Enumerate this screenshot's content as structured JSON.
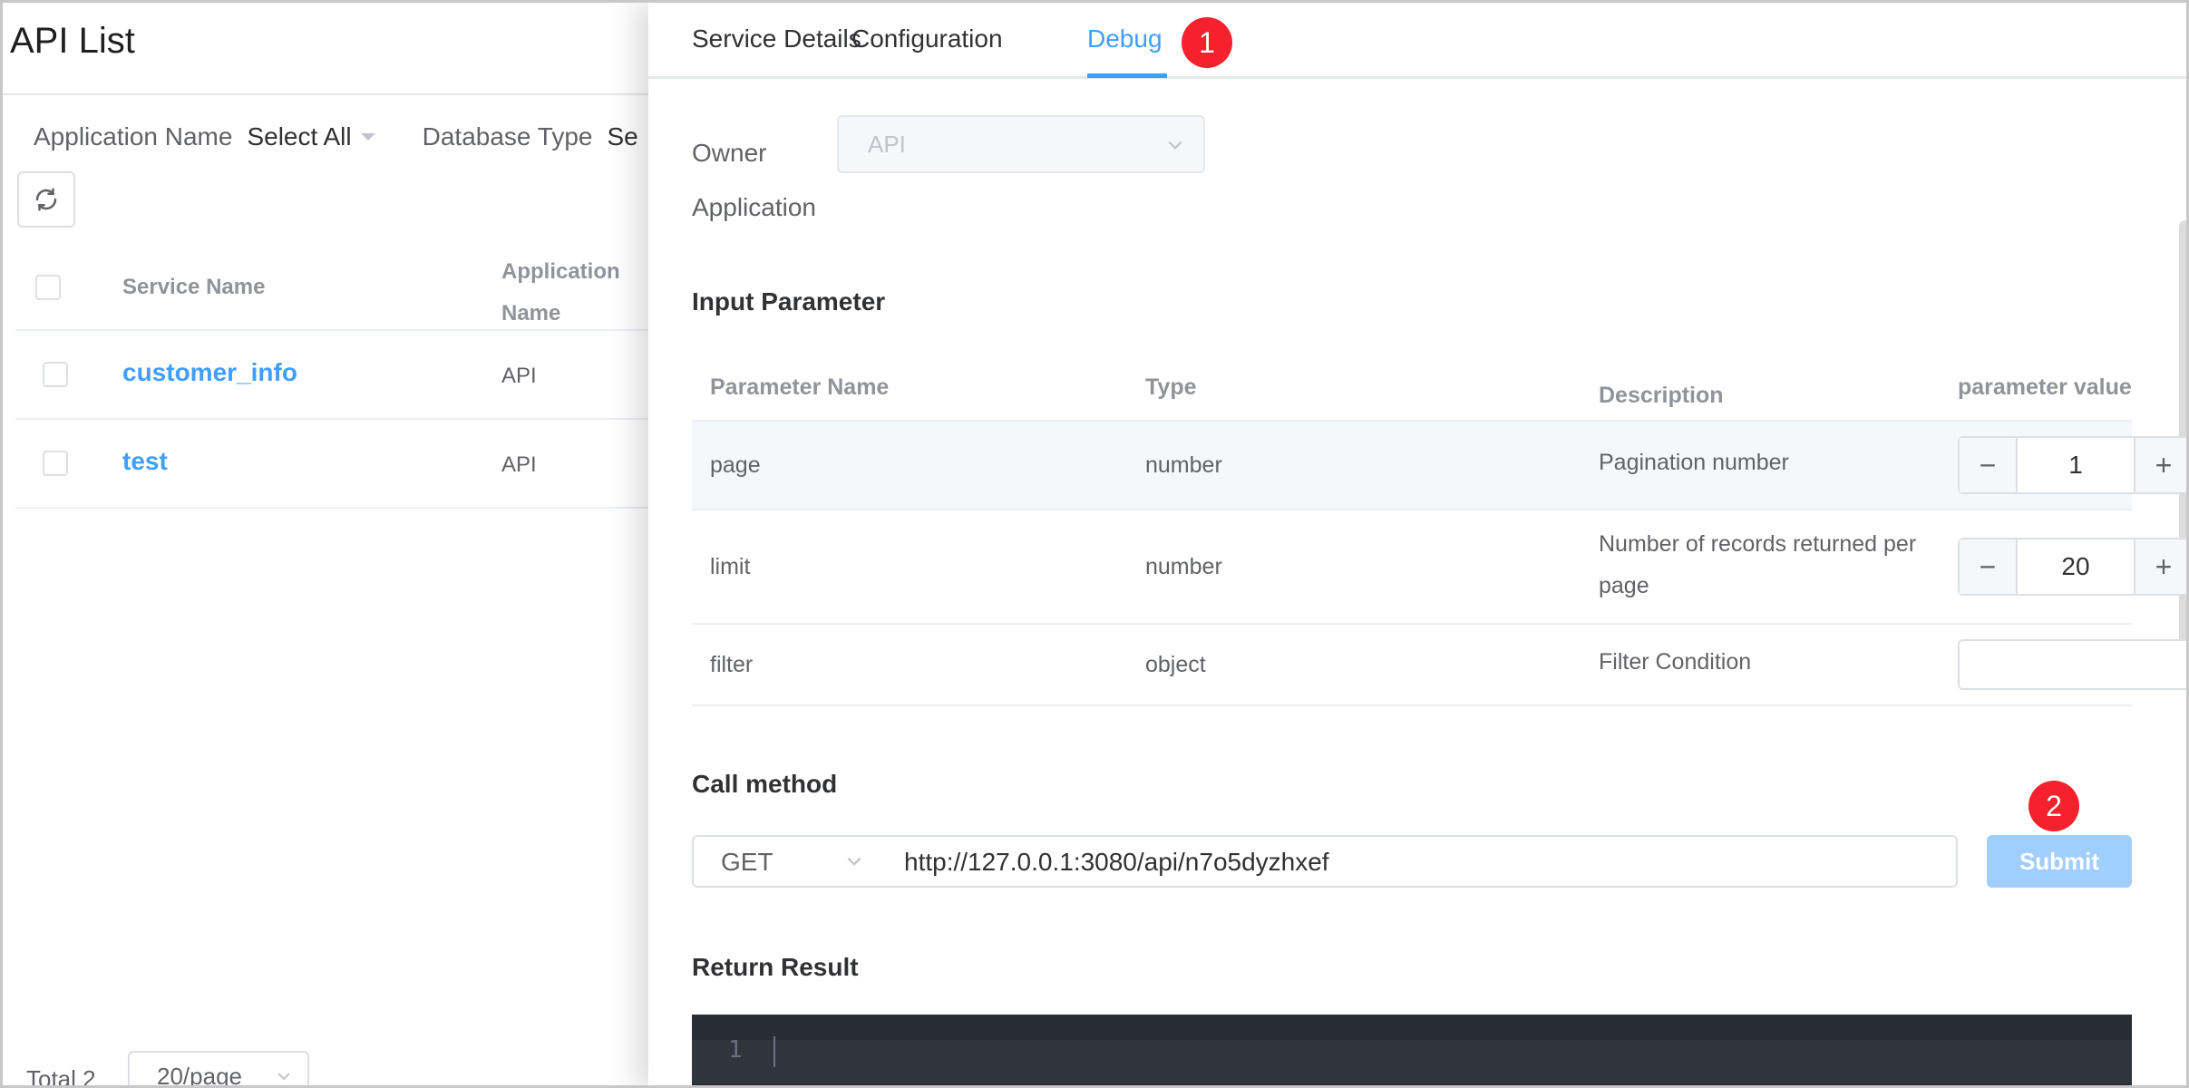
{
  "page": {
    "title": "API List"
  },
  "filters": {
    "app_label": "Application Name",
    "app_value": "Select All",
    "db_label": "Database Type",
    "db_value": "Se"
  },
  "list_table": {
    "headers": {
      "service_name": "Service Name",
      "application_name": "Application Name"
    },
    "rows": [
      {
        "service_name": "customer_info",
        "application_name": "API"
      },
      {
        "service_name": "test",
        "application_name": "API"
      }
    ]
  },
  "pagination": {
    "total": "Total 2",
    "page_size": "20/page"
  },
  "drawer": {
    "tabs": [
      {
        "label": "Service Details"
      },
      {
        "label": "Configuration"
      },
      {
        "label": "Debug"
      }
    ],
    "active_tab": "Debug",
    "badges": [
      "1",
      "2"
    ],
    "owner": {
      "label": "Owner Application",
      "value": "API"
    },
    "input_parameter": {
      "title": "Input Parameter",
      "headers": [
        "Parameter Name",
        "Type",
        "Description",
        "parameter value"
      ],
      "rows": [
        {
          "name": "page",
          "type": "number",
          "description": "Pagination number",
          "value": "1"
        },
        {
          "name": "limit",
          "type": "number",
          "description": "Number of records returned per page",
          "value": "20"
        },
        {
          "name": "filter",
          "type": "object",
          "description": "Filter Condition",
          "value": ""
        }
      ]
    },
    "call_method": {
      "title": "Call method",
      "method": "GET",
      "url": "http://127.0.0.1:3080/api/n7o5dyzhxef",
      "submit_label": "Submit"
    },
    "return_result": {
      "title": "Return Result",
      "line_numbers": [
        "1"
      ]
    }
  },
  "colors": {
    "accent": "#409eff",
    "badge": "#f5222d",
    "submit_disabled": "#a0cfff",
    "code_bg": "#282c34"
  }
}
